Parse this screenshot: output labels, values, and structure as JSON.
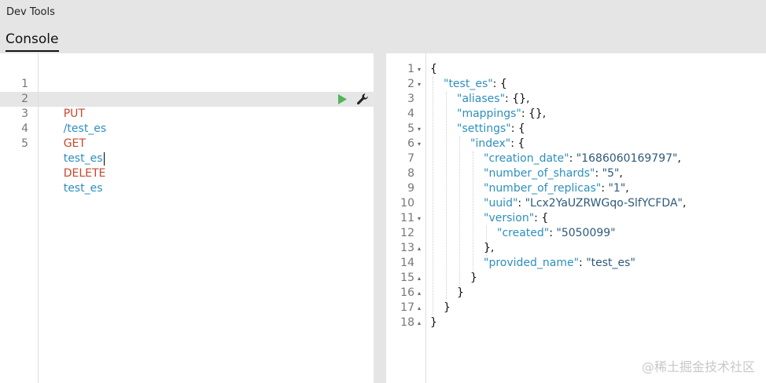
{
  "app": {
    "title": "Dev Tools"
  },
  "tabs": [
    {
      "label": "Console",
      "active": true
    }
  ],
  "editor": {
    "lines": [
      {
        "num": "1",
        "method": "PUT",
        "path": "/test_es"
      },
      {
        "num": "2",
        "method": "",
        "path": ""
      },
      {
        "num": "3",
        "method": "GET",
        "path": "test_es"
      },
      {
        "num": "4",
        "method": "",
        "path": ""
      },
      {
        "num": "5",
        "method": "DELETE",
        "path": "test_es"
      }
    ],
    "active_line": "3"
  },
  "response": {
    "lines": [
      {
        "num": "1",
        "fold": "▾",
        "parts": [
          [
            "punc",
            "{"
          ]
        ]
      },
      {
        "num": "2",
        "fold": "▾",
        "parts": [
          [
            "key",
            "\"test_es\""
          ],
          [
            "punc",
            ": {"
          ]
        ]
      },
      {
        "num": "3",
        "fold": "",
        "parts": [
          [
            "key",
            "\"aliases\""
          ],
          [
            "punc",
            ": {},"
          ]
        ]
      },
      {
        "num": "4",
        "fold": "",
        "parts": [
          [
            "key",
            "\"mappings\""
          ],
          [
            "punc",
            ": {},"
          ]
        ]
      },
      {
        "num": "5",
        "fold": "▾",
        "parts": [
          [
            "key",
            "\"settings\""
          ],
          [
            "punc",
            ": {"
          ]
        ]
      },
      {
        "num": "6",
        "fold": "▾",
        "parts": [
          [
            "key",
            "\"index\""
          ],
          [
            "punc",
            ": {"
          ]
        ]
      },
      {
        "num": "7",
        "fold": "",
        "parts": [
          [
            "key",
            "\"creation_date\""
          ],
          [
            "punc",
            ": "
          ],
          [
            "str",
            "\"1686060169797\""
          ],
          [
            "punc",
            ","
          ]
        ]
      },
      {
        "num": "8",
        "fold": "",
        "parts": [
          [
            "key",
            "\"number_of_shards\""
          ],
          [
            "punc",
            ": "
          ],
          [
            "str",
            "\"5\""
          ],
          [
            "punc",
            ","
          ]
        ]
      },
      {
        "num": "9",
        "fold": "",
        "parts": [
          [
            "key",
            "\"number_of_replicas\""
          ],
          [
            "punc",
            ": "
          ],
          [
            "str",
            "\"1\""
          ],
          [
            "punc",
            ","
          ]
        ]
      },
      {
        "num": "10",
        "fold": "",
        "parts": [
          [
            "key",
            "\"uuid\""
          ],
          [
            "punc",
            ": "
          ],
          [
            "str",
            "\"Lcx2YaUZRWGqo-SlfYCFDA\""
          ],
          [
            "punc",
            ","
          ]
        ]
      },
      {
        "num": "11",
        "fold": "▾",
        "parts": [
          [
            "key",
            "\"version\""
          ],
          [
            "punc",
            ": {"
          ]
        ]
      },
      {
        "num": "12",
        "fold": "",
        "parts": [
          [
            "key",
            "\"created\""
          ],
          [
            "punc",
            ": "
          ],
          [
            "str",
            "\"5050099\""
          ]
        ]
      },
      {
        "num": "13",
        "fold": "▴",
        "parts": [
          [
            "punc",
            "},"
          ]
        ]
      },
      {
        "num": "14",
        "fold": "",
        "parts": [
          [
            "key",
            "\"provided_name\""
          ],
          [
            "punc",
            ": "
          ],
          [
            "str",
            "\"test_es\""
          ]
        ]
      },
      {
        "num": "15",
        "fold": "▴",
        "parts": [
          [
            "punc",
            "}"
          ]
        ]
      },
      {
        "num": "16",
        "fold": "▴",
        "parts": [
          [
            "punc",
            "}"
          ]
        ]
      },
      {
        "num": "17",
        "fold": "▴",
        "parts": [
          [
            "punc",
            "}"
          ]
        ]
      },
      {
        "num": "18",
        "fold": "▴",
        "parts": [
          [
            "punc",
            "}"
          ]
        ]
      }
    ]
  },
  "icons": {
    "run": "play-icon",
    "settings": "wrench-icon"
  },
  "colors": {
    "method": "#c7462d",
    "path": "#2d8fbd",
    "run": "#54b45a"
  },
  "watermark": "@稀土掘金技术社区"
}
